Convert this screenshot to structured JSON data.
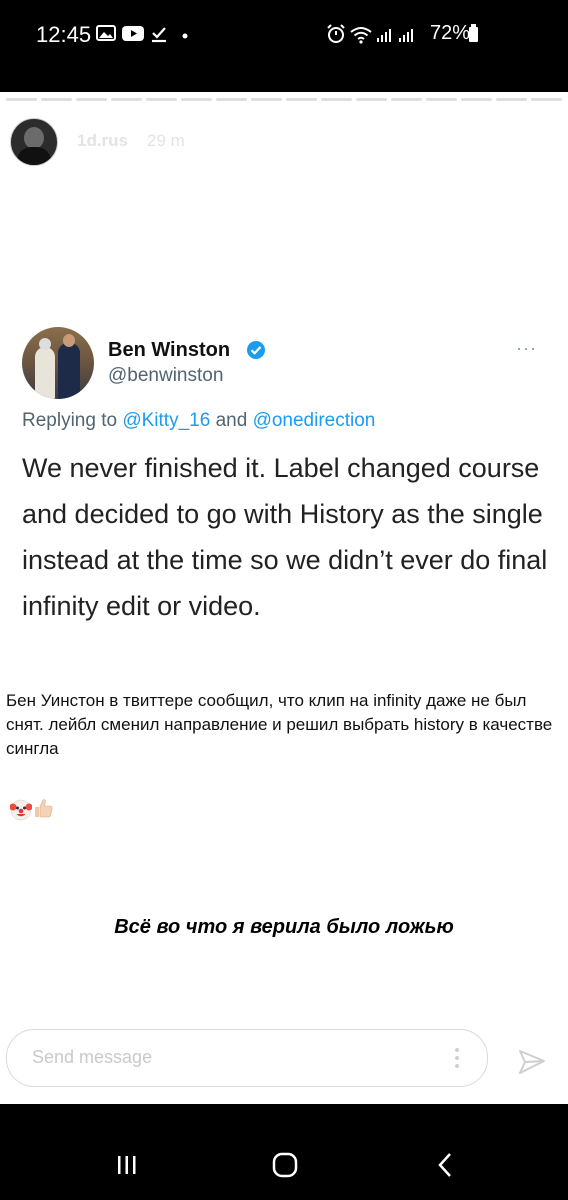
{
  "status_bar": {
    "time": "12:45",
    "battery": "72%",
    "left_icons": [
      "image-icon",
      "youtube-icon",
      "download-done-icon",
      "dot-icon"
    ],
    "right_icons": [
      "alarm-icon",
      "wifi-icon",
      "signal-icon",
      "signal-icon",
      "battery-icon"
    ]
  },
  "story": {
    "username": "1d.rus",
    "time_ago": "29 m",
    "tweet": {
      "name": "Ben Winston",
      "handle": "@benwinston",
      "replying_prefix": "Replying to ",
      "mention_1": "@Kitty_16",
      "and": " and ",
      "mention_2": "@onedirection",
      "text": "We never finished it. Label changed course and decided to go with History as the single instead at the time so we didn’t ever do final infinity edit or video.",
      "more": "···"
    },
    "caption": "Бен Уинстон в твиттере сообщил, что клип на infinity даже не был снят. лейбл сменил направление и решил выбрать history в качестве сингла",
    "emojis": [
      "clown-face",
      "thumbs-up"
    ],
    "overlay_text": "Всё во что я верила было ложью",
    "message_placeholder": "Send message"
  },
  "colors": {
    "mention": "#1d9bf0",
    "verified": "#1d9bf0",
    "handle": "#536471"
  }
}
